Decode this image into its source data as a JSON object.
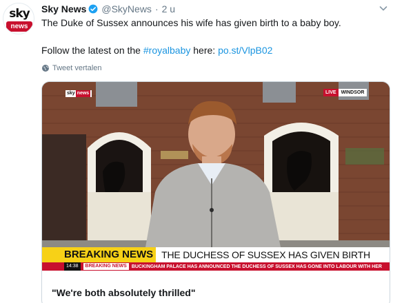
{
  "account": {
    "avatar_top": "sky",
    "avatar_bottom": "news",
    "name": "Sky News",
    "handle": "@SkyNews",
    "separator": "·",
    "time": "2 u"
  },
  "tweet": {
    "line1": "The Duke of Sussex announces his wife has given birth to a baby boy.",
    "line2_prefix": "Follow the latest on the ",
    "hashtag": "#royalbaby",
    "line2_mid": " here: ",
    "link": "po.st/VlpB02"
  },
  "translate_label": "Tweet vertalen",
  "card": {
    "title": "\"We're both absolutely thrilled\"",
    "overlay": {
      "logo_sky": "sky",
      "logo_news": "news",
      "live": "LIVE",
      "location": "WINDSOR",
      "breaking_label": "BREAKING NEWS",
      "headline": "THE DUCHESS OF SUSSEX HAS GIVEN BIRTH",
      "clock": "14:38",
      "ticker_label": "BREAKING NEWS",
      "ticker_text": "BUCKINGHAM PALACE HAS ANNOUNCED THE DUCHESS OF SUSSEX HAS GONE INTO LABOUR WITH HER"
    }
  },
  "colors": {
    "link": "#1b95e0",
    "verified": "#1da1f2",
    "secondary_text": "#657786",
    "sky_red": "#c8102e",
    "breaking_yellow": "#f7d117"
  },
  "icons": [
    "verified-badge-icon",
    "chevron-down-icon",
    "globe-icon"
  ]
}
